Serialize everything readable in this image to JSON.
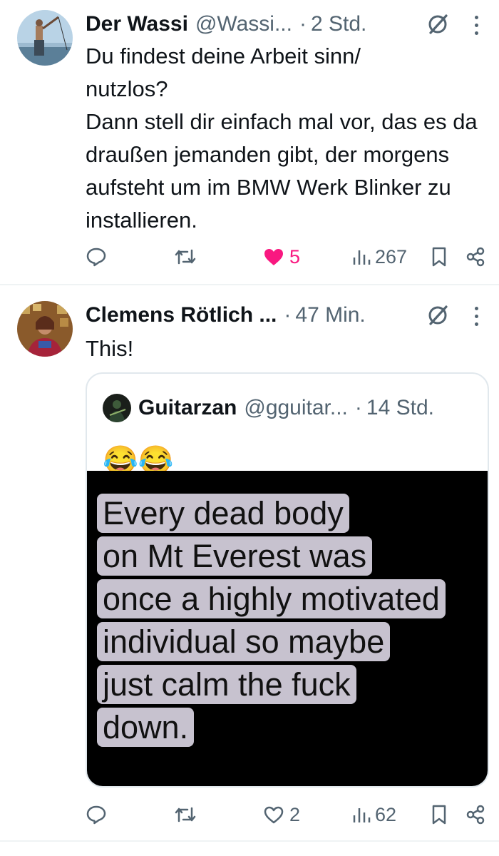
{
  "tweets": [
    {
      "author_name": "Der Wassi",
      "handle": "@Wassi...",
      "separator": "·",
      "time": "2 Std.",
      "text": "Du findest deine Arbeit sinn/\nnutzlos?\nDann stell dir einfach mal vor, das es da draußen jemanden gibt, der morgens aufsteht um im BMW Werk Blinker zu installieren.",
      "replies": "",
      "reposts": "",
      "likes": "5",
      "liked": true,
      "views": "267"
    },
    {
      "author_name": "Clemens Rötlich ...",
      "separator": "·",
      "time": "47 Min.",
      "text": "This!",
      "replies": "",
      "reposts": "",
      "likes": "2",
      "liked": false,
      "views": "62",
      "quoted": {
        "author_name": "Guitarzan",
        "handle": "@gguitar...",
        "separator": "·",
        "time": "14 Std.",
        "text": "😂😂",
        "media_text_lines": [
          "Every dead body",
          "on Mt Everest was",
          "once a highly motivated",
          "individual so maybe",
          "just calm the fuck",
          "down."
        ]
      }
    }
  ],
  "colors": {
    "text": "#0f1419",
    "secondary": "#536471",
    "like_active": "#f91880",
    "divider": "#eff3f4"
  },
  "icons": [
    "reply-icon",
    "repost-icon",
    "like-icon",
    "views-icon",
    "bookmark-icon",
    "share-icon",
    "grok-icon",
    "more-icon"
  ]
}
